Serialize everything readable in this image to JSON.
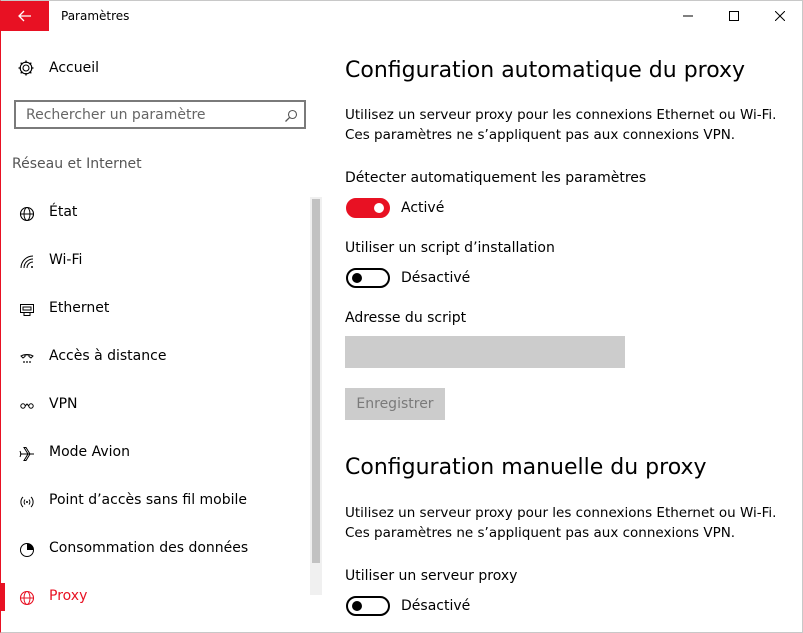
{
  "window": {
    "title": "Paramètres"
  },
  "sidebar": {
    "home_label": "Accueil",
    "search_placeholder": "Rechercher un paramètre",
    "section_label": "Réseau et Internet",
    "items": [
      {
        "label": "État",
        "icon": "globe-status-icon"
      },
      {
        "label": "Wi-Fi",
        "icon": "wifi-icon"
      },
      {
        "label": "Ethernet",
        "icon": "ethernet-icon"
      },
      {
        "label": "Accès à distance",
        "icon": "dial-up-icon"
      },
      {
        "label": "VPN",
        "icon": "vpn-icon"
      },
      {
        "label": "Mode Avion",
        "icon": "airplane-icon"
      },
      {
        "label": "Point d’accès sans fil mobile",
        "icon": "mobile-hotspot-icon"
      },
      {
        "label": "Consommation des données",
        "icon": "data-usage-icon"
      },
      {
        "label": "Proxy",
        "icon": "globe-icon",
        "active": true
      }
    ]
  },
  "auto_proxy": {
    "heading": "Configuration automatique du proxy",
    "desc_line1": "Utilisez un serveur proxy pour les connexions Ethernet ou Wi-Fi.",
    "desc_line2": "Ces paramètres ne s’appliquent pas aux connexions VPN.",
    "detect_label": "Détecter automatiquement les paramètres",
    "detect_state": "Activé",
    "script_label": "Utiliser un script d’installation",
    "script_state": "Désactivé",
    "address_label": "Adresse du script",
    "address_value": "",
    "save_label": "Enregistrer"
  },
  "manual_proxy": {
    "heading": "Configuration manuelle du proxy",
    "desc_line1": "Utilisez un serveur proxy pour les connexions Ethernet ou Wi-Fi.",
    "desc_line2": "Ces paramètres ne s’appliquent pas aux connexions VPN.",
    "use_label": "Utiliser un serveur proxy",
    "use_state": "Désactivé"
  },
  "colors": {
    "accent": "#e81123",
    "disabled_bg": "#cccccc"
  }
}
